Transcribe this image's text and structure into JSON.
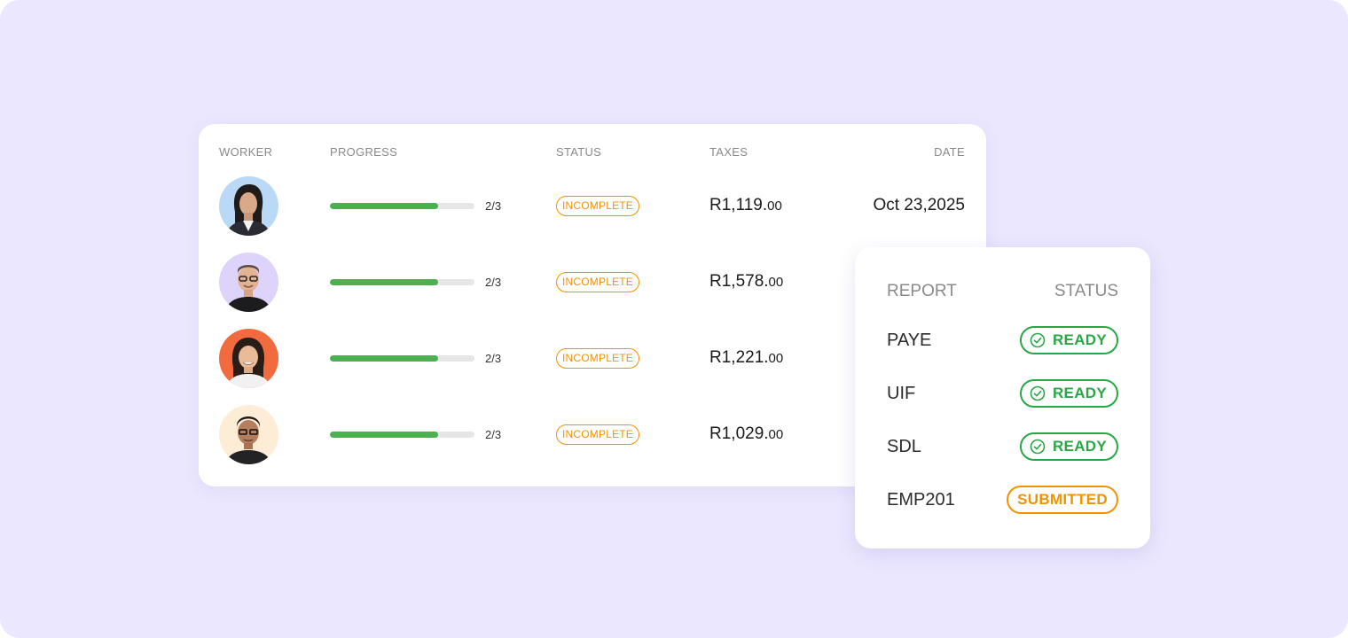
{
  "workers_table": {
    "columns": {
      "worker": "WORKER",
      "progress": "PROGRESS",
      "status": "STATUS",
      "taxes": "TAXES",
      "date": "DATE"
    },
    "rows": [
      {
        "avatar_bg": "#b9d9f7",
        "progress": 0.75,
        "steps": "2/3",
        "status": "INCOMPLETE",
        "tax_main": "R1,119.",
        "tax_cents": "00",
        "date": "Oct 23,2025"
      },
      {
        "avatar_bg": "#ddd3fb",
        "progress": 0.75,
        "steps": "2/3",
        "status": "INCOMPLETE",
        "tax_main": "R1,578.",
        "tax_cents": "00",
        "date": ""
      },
      {
        "avatar_bg": "#f26b3f",
        "progress": 0.75,
        "steps": "2/3",
        "status": "INCOMPLETE",
        "tax_main": "R1,221.",
        "tax_cents": "00",
        "date": ""
      },
      {
        "avatar_bg": "#fdecd6",
        "progress": 0.75,
        "steps": "2/3",
        "status": "INCOMPLETE",
        "tax_main": "R1,029.",
        "tax_cents": "00",
        "date": ""
      }
    ]
  },
  "report_card": {
    "columns": {
      "report": "REPORT",
      "status": "STATUS"
    },
    "rows": [
      {
        "name": "PAYE",
        "status": "READY",
        "icon": "check-circle-icon"
      },
      {
        "name": "UIF",
        "status": "READY",
        "icon": "check-circle-icon"
      },
      {
        "name": "SDL",
        "status": "READY",
        "icon": "check-circle-icon"
      },
      {
        "name": "EMP201",
        "status": "SUBMITTED"
      }
    ]
  },
  "colors": {
    "background": "#ebe7ff",
    "progress_fill": "#4caf50",
    "incomplete": "#f39200",
    "ready": "#27a844",
    "submitted": "#f39200"
  }
}
